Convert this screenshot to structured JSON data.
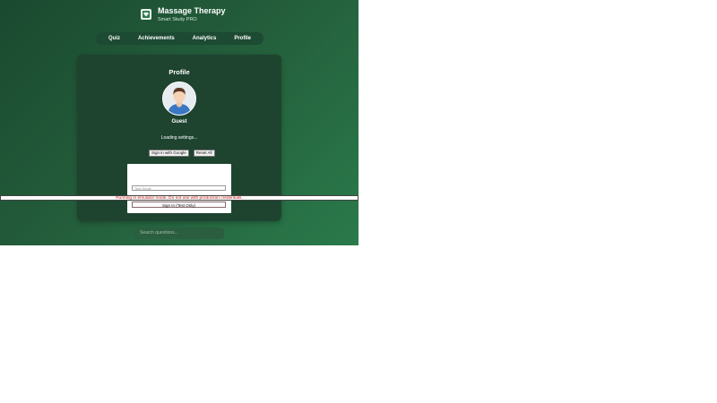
{
  "app": {
    "title": "Massage Therapy",
    "subtitle": "Smart Study PRO"
  },
  "nav": {
    "items": [
      "Quiz",
      "Achievements",
      "Analytics",
      "Profile"
    ]
  },
  "profile": {
    "title": "Profile",
    "username": "Guest",
    "status": "Loading settings...",
    "google_signin_label": "Sign in with Google",
    "reset_label": "Reset All"
  },
  "test_login": {
    "email_placeholder": "Test Email",
    "signin_label": "Sign In (Test Only)"
  },
  "emulator_warning": "Running in emulator mode. Do not use with production credentials.",
  "search": {
    "placeholder": "Search questions..."
  },
  "colors": {
    "background_start": "#1a4a30",
    "background_end": "#2a7a4b",
    "card": "#1e4430",
    "warning_text": "#c21a1a"
  },
  "icons": {
    "logo": "heart-book-icon",
    "avatar": "user-avatar-icon"
  }
}
